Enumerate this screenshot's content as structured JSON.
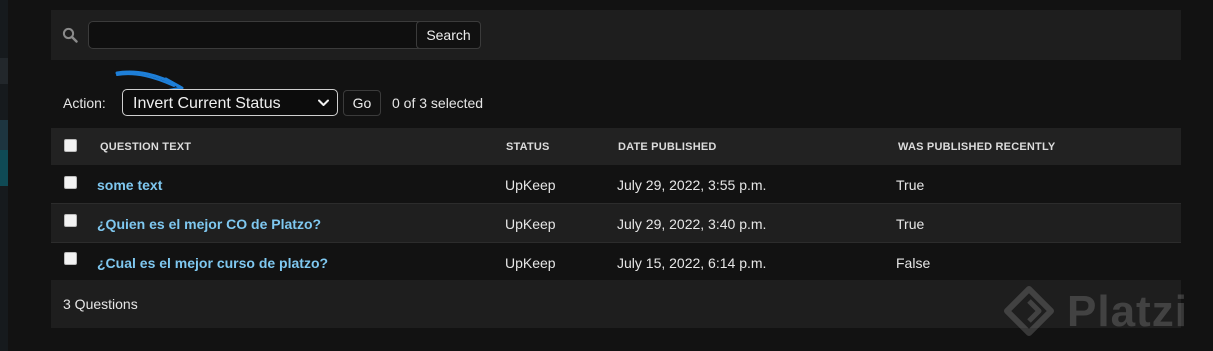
{
  "toolbar": {
    "search_value": "",
    "search_button_label": "Search"
  },
  "actions": {
    "label": "Action:",
    "selected_action": "Invert Current Status",
    "go_label": "Go",
    "selected_count": "0 of 3 selected"
  },
  "table": {
    "headers": {
      "question_text": "QUESTION TEXT",
      "status": "STATUS",
      "date_published": "DATE PUBLISHED",
      "was_published_recently": "WAS PUBLISHED RECENTLY"
    },
    "rows": [
      {
        "question_text": "some text",
        "status": "UpKeep",
        "date_published": "July 29, 2022, 3:55 p.m.",
        "was_published_recently": "True"
      },
      {
        "question_text": "¿Quien es el mejor CO de Platzo?",
        "status": "UpKeep",
        "date_published": "July 29, 2022, 3:40 p.m.",
        "was_published_recently": "True"
      },
      {
        "question_text": "¿Cual es el mejor curso de platzo?",
        "status": "UpKeep",
        "date_published": "July 15, 2022, 6:14 p.m.",
        "was_published_recently": "False"
      }
    ]
  },
  "footer": {
    "count_text": "3 Questions"
  },
  "watermark": {
    "text": "Platzi"
  },
  "colors": {
    "background": "#121212",
    "link": "#7fc8f0",
    "annotation_arrow": "#1e7fd8"
  },
  "icons": [
    "search-icon",
    "chevron-down-icon",
    "annotation-arrow-icon",
    "platzi-logo-icon"
  ]
}
